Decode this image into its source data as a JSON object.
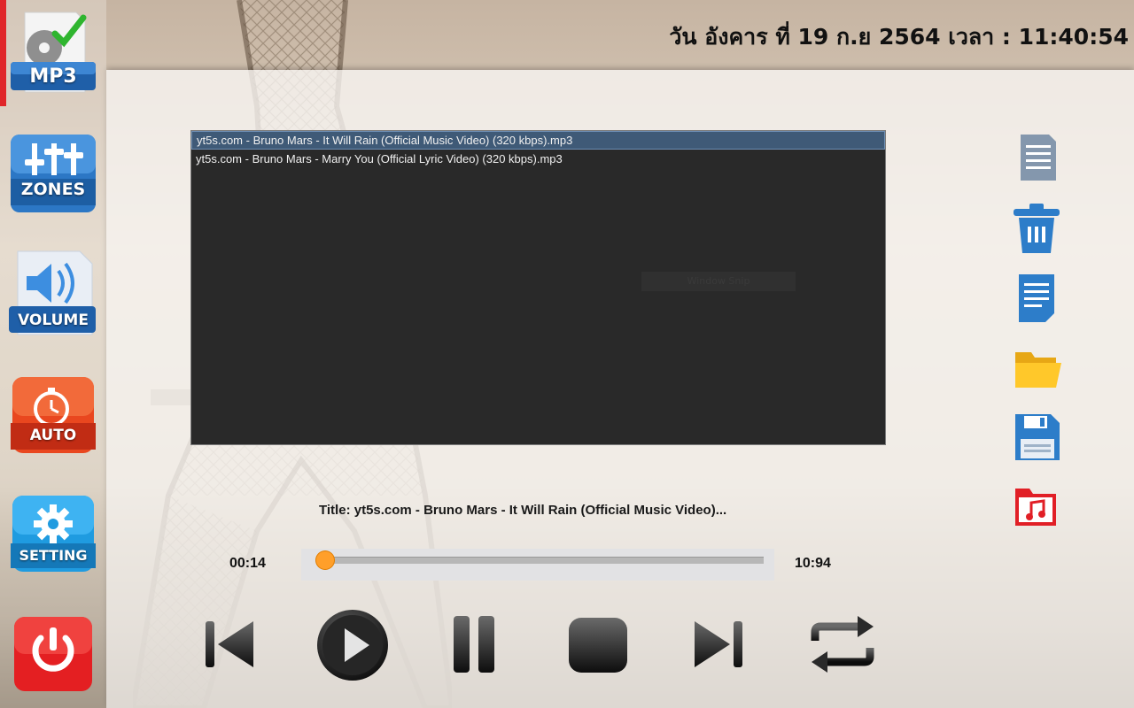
{
  "header": {
    "datetime": "วัน อังคาร ที่ 19 ก.ย 2564 เวลา : 11:40:54"
  },
  "sidebar": {
    "items": [
      {
        "id": "mp3",
        "label": "MP3",
        "icon": "mp3-disc-check-icon",
        "active": true
      },
      {
        "id": "zones",
        "label": "ZONES",
        "icon": "equalizer-sliders-icon"
      },
      {
        "id": "volume",
        "label": "VOLUME",
        "icon": "speaker-icon"
      },
      {
        "id": "auto",
        "label": "AUTO",
        "icon": "stopwatch-icon"
      },
      {
        "id": "setting",
        "label": "SETTING",
        "icon": "gear-icon"
      },
      {
        "id": "power",
        "label": "",
        "icon": "power-icon"
      }
    ]
  },
  "playlist": {
    "items": [
      {
        "label": "yt5s.com - Bruno Mars - It Will Rain (Official Music Video) (320 kbps).mp3",
        "selected": true
      },
      {
        "label": "yt5s.com - Bruno Mars - Marry You (Official Lyric Video) (320 kbps).mp3",
        "selected": false
      }
    ],
    "ghost_label": "Window Snip"
  },
  "toolbar": {
    "icons": [
      "document-icon",
      "trash-icon",
      "text-file-icon",
      "folder-icon",
      "save-icon",
      "music-folder-icon"
    ]
  },
  "player": {
    "title": "Title: yt5s.com - Bruno Mars - It Will Rain (Official Music Video)...",
    "elapsed": "00:14",
    "duration": "10:94",
    "progress_fraction": 0.01,
    "controls": [
      "previous-icon",
      "play-icon",
      "pause-icon",
      "stop-icon",
      "next-icon",
      "repeat-icon"
    ]
  },
  "colors": {
    "accent": "#e0262a",
    "playlist_bg": "#292929",
    "selection": "#3f5a77",
    "progress_knob": "#ff9f2a",
    "sidebar_blue": "#2c77c5",
    "auto_red": "#e9471f"
  }
}
